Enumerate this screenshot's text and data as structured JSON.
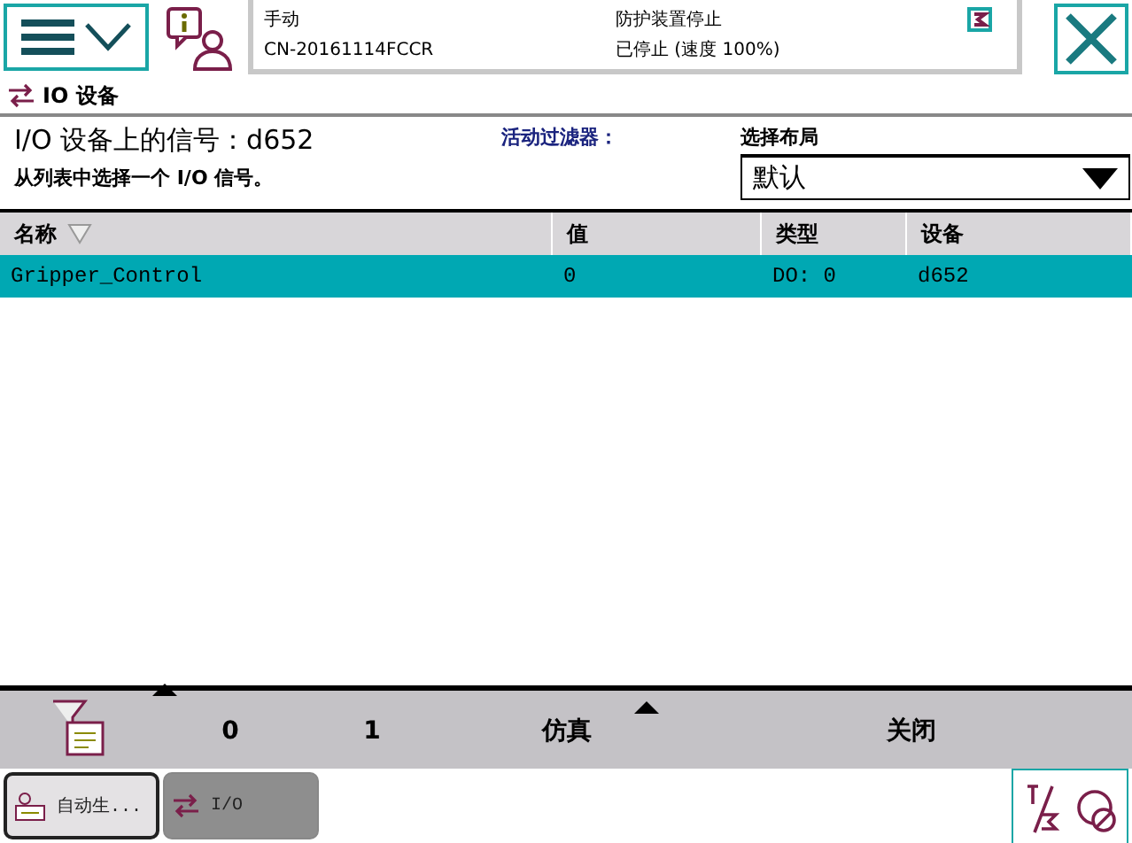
{
  "status": {
    "mode": "手动",
    "controller": "CN-20161114FCCR",
    "safety": "防护装置停止",
    "state": "已停止 (速度 100%)"
  },
  "app_title": "IO 设备",
  "heading": "I/O 设备上的信号：d652",
  "instruction": "从列表中选择一个 I/O 信号。",
  "filter_label": "活动过滤器：",
  "layout": {
    "label": "选择布局",
    "value": "默认"
  },
  "table": {
    "columns": [
      "名称",
      "值",
      "类型",
      "设备"
    ],
    "rows": [
      {
        "cells": [
          "Gripper_Control",
          "0",
          "DO: 0",
          "d652"
        ],
        "selected": true
      }
    ]
  },
  "commands": [
    "0",
    "1",
    "仿真",
    "关闭"
  ],
  "taskbar": [
    {
      "label": "自动生...",
      "selected": true
    },
    {
      "label": "I/O",
      "selected": false
    }
  ]
}
